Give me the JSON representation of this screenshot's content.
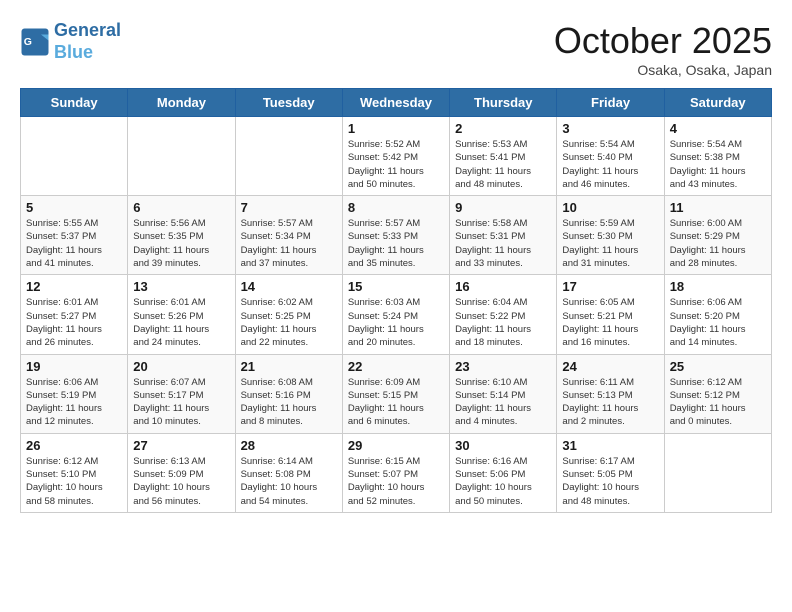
{
  "header": {
    "logo_line1": "General",
    "logo_line2": "Blue",
    "month": "October 2025",
    "location": "Osaka, Osaka, Japan"
  },
  "weekdays": [
    "Sunday",
    "Monday",
    "Tuesday",
    "Wednesday",
    "Thursday",
    "Friday",
    "Saturday"
  ],
  "weeks": [
    [
      {
        "day": "",
        "info": ""
      },
      {
        "day": "",
        "info": ""
      },
      {
        "day": "",
        "info": ""
      },
      {
        "day": "1",
        "info": "Sunrise: 5:52 AM\nSunset: 5:42 PM\nDaylight: 11 hours\nand 50 minutes."
      },
      {
        "day": "2",
        "info": "Sunrise: 5:53 AM\nSunset: 5:41 PM\nDaylight: 11 hours\nand 48 minutes."
      },
      {
        "day": "3",
        "info": "Sunrise: 5:54 AM\nSunset: 5:40 PM\nDaylight: 11 hours\nand 46 minutes."
      },
      {
        "day": "4",
        "info": "Sunrise: 5:54 AM\nSunset: 5:38 PM\nDaylight: 11 hours\nand 43 minutes."
      }
    ],
    [
      {
        "day": "5",
        "info": "Sunrise: 5:55 AM\nSunset: 5:37 PM\nDaylight: 11 hours\nand 41 minutes."
      },
      {
        "day": "6",
        "info": "Sunrise: 5:56 AM\nSunset: 5:35 PM\nDaylight: 11 hours\nand 39 minutes."
      },
      {
        "day": "7",
        "info": "Sunrise: 5:57 AM\nSunset: 5:34 PM\nDaylight: 11 hours\nand 37 minutes."
      },
      {
        "day": "8",
        "info": "Sunrise: 5:57 AM\nSunset: 5:33 PM\nDaylight: 11 hours\nand 35 minutes."
      },
      {
        "day": "9",
        "info": "Sunrise: 5:58 AM\nSunset: 5:31 PM\nDaylight: 11 hours\nand 33 minutes."
      },
      {
        "day": "10",
        "info": "Sunrise: 5:59 AM\nSunset: 5:30 PM\nDaylight: 11 hours\nand 31 minutes."
      },
      {
        "day": "11",
        "info": "Sunrise: 6:00 AM\nSunset: 5:29 PM\nDaylight: 11 hours\nand 28 minutes."
      }
    ],
    [
      {
        "day": "12",
        "info": "Sunrise: 6:01 AM\nSunset: 5:27 PM\nDaylight: 11 hours\nand 26 minutes."
      },
      {
        "day": "13",
        "info": "Sunrise: 6:01 AM\nSunset: 5:26 PM\nDaylight: 11 hours\nand 24 minutes."
      },
      {
        "day": "14",
        "info": "Sunrise: 6:02 AM\nSunset: 5:25 PM\nDaylight: 11 hours\nand 22 minutes."
      },
      {
        "day": "15",
        "info": "Sunrise: 6:03 AM\nSunset: 5:24 PM\nDaylight: 11 hours\nand 20 minutes."
      },
      {
        "day": "16",
        "info": "Sunrise: 6:04 AM\nSunset: 5:22 PM\nDaylight: 11 hours\nand 18 minutes."
      },
      {
        "day": "17",
        "info": "Sunrise: 6:05 AM\nSunset: 5:21 PM\nDaylight: 11 hours\nand 16 minutes."
      },
      {
        "day": "18",
        "info": "Sunrise: 6:06 AM\nSunset: 5:20 PM\nDaylight: 11 hours\nand 14 minutes."
      }
    ],
    [
      {
        "day": "19",
        "info": "Sunrise: 6:06 AM\nSunset: 5:19 PM\nDaylight: 11 hours\nand 12 minutes."
      },
      {
        "day": "20",
        "info": "Sunrise: 6:07 AM\nSunset: 5:17 PM\nDaylight: 11 hours\nand 10 minutes."
      },
      {
        "day": "21",
        "info": "Sunrise: 6:08 AM\nSunset: 5:16 PM\nDaylight: 11 hours\nand 8 minutes."
      },
      {
        "day": "22",
        "info": "Sunrise: 6:09 AM\nSunset: 5:15 PM\nDaylight: 11 hours\nand 6 minutes."
      },
      {
        "day": "23",
        "info": "Sunrise: 6:10 AM\nSunset: 5:14 PM\nDaylight: 11 hours\nand 4 minutes."
      },
      {
        "day": "24",
        "info": "Sunrise: 6:11 AM\nSunset: 5:13 PM\nDaylight: 11 hours\nand 2 minutes."
      },
      {
        "day": "25",
        "info": "Sunrise: 6:12 AM\nSunset: 5:12 PM\nDaylight: 11 hours\nand 0 minutes."
      }
    ],
    [
      {
        "day": "26",
        "info": "Sunrise: 6:12 AM\nSunset: 5:10 PM\nDaylight: 10 hours\nand 58 minutes."
      },
      {
        "day": "27",
        "info": "Sunrise: 6:13 AM\nSunset: 5:09 PM\nDaylight: 10 hours\nand 56 minutes."
      },
      {
        "day": "28",
        "info": "Sunrise: 6:14 AM\nSunset: 5:08 PM\nDaylight: 10 hours\nand 54 minutes."
      },
      {
        "day": "29",
        "info": "Sunrise: 6:15 AM\nSunset: 5:07 PM\nDaylight: 10 hours\nand 52 minutes."
      },
      {
        "day": "30",
        "info": "Sunrise: 6:16 AM\nSunset: 5:06 PM\nDaylight: 10 hours\nand 50 minutes."
      },
      {
        "day": "31",
        "info": "Sunrise: 6:17 AM\nSunset: 5:05 PM\nDaylight: 10 hours\nand 48 minutes."
      },
      {
        "day": "",
        "info": ""
      }
    ]
  ]
}
